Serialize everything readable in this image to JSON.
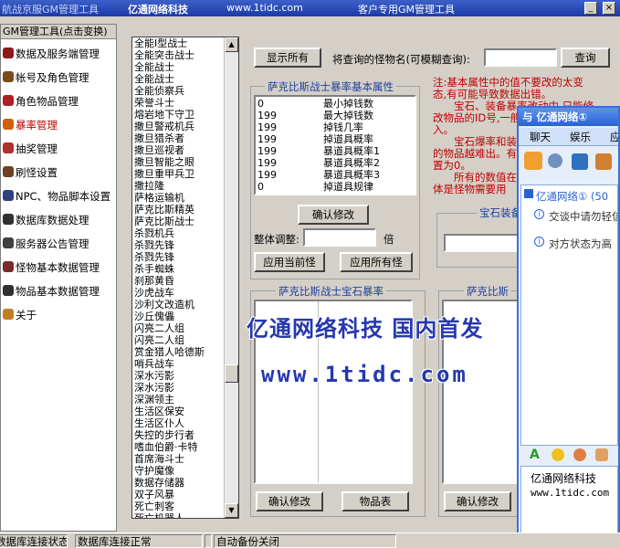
{
  "titlebar": {
    "app_name": "航战京服GM管理工具",
    "company": "亿通网络科技",
    "url": "www.1tidc.com",
    "subtitle": "客户专用GM管理工具",
    "min_glyph": "_",
    "close_glyph": "×"
  },
  "nav": {
    "header": "GM管理工具(点击变换)",
    "items": [
      {
        "label": "数据及服务端管理",
        "icon": "book-icon",
        "color": "#8b1a1a"
      },
      {
        "label": "帐号及角色管理",
        "icon": "key-icon",
        "color": "#7a4a1a"
      },
      {
        "label": "角色物品管理",
        "icon": "bag-icon",
        "color": "#b02020"
      },
      {
        "label": "暴率管理",
        "icon": "dice-icon",
        "color": "#d06010"
      },
      {
        "label": "抽奖管理",
        "icon": "lottery-icon",
        "color": "#b03030"
      },
      {
        "label": "刷怪设置",
        "icon": "monster-icon",
        "color": "#704020"
      },
      {
        "label": "NPC、物品脚本设置",
        "icon": "script-icon",
        "color": "#304080"
      },
      {
        "label": "数据库数据处理",
        "icon": "database-icon",
        "color": "#303030"
      },
      {
        "label": "服务器公告管理",
        "icon": "announce-icon",
        "color": "#404040"
      },
      {
        "label": "怪物基本数据管理",
        "icon": "beast-icon",
        "color": "#7a2a2a"
      },
      {
        "label": "物品基本数据管理",
        "icon": "item-icon",
        "color": "#303030"
      },
      {
        "label": "关于",
        "icon": "info-icon",
        "color": "#c08020"
      }
    ]
  },
  "monster_list": [
    "全能I型战士",
    "全能突击战士",
    "全能战士",
    "全能战士",
    "全能侦察兵",
    "荣誉斗士",
    "熔岩地下守卫",
    "撒旦警戒机兵",
    "撒旦猎杀者",
    "撒旦巡视者",
    "撒旦智能之眼",
    "撒旦重甲兵卫",
    "撒拉隆",
    "萨格运输机",
    "萨克比斯精英",
    "萨克比斯战士",
    "杀戮机兵",
    "杀戮先锋",
    "杀戮先锋",
    "杀手蜘蛛",
    "刹那黄昏",
    "沙虎战车",
    "沙利文改造机",
    "沙丘傀儡",
    "闪亮二人组",
    "闪亮二人组",
    "赏金猎人哈德斯",
    "哨兵战车",
    "深水污影",
    "深水污影",
    "深渊领主",
    "生活区保安",
    "生活区仆人",
    "失控的步行者",
    "嗜血伯爵·卡特",
    "首席海斗士",
    "守护魔像",
    "数据存储器",
    "双子风暴",
    "死亡刺客",
    "死亡机器人"
  ],
  "search": {
    "show_all": "显示所有",
    "label": "将查询的怪物名(可模糊查询):",
    "value": "",
    "button": "查询"
  },
  "drop_group": {
    "title": "萨克比斯战士暴率基本属性",
    "rows": [
      {
        "value": "0",
        "name": "最小掉钱数"
      },
      {
        "value": "199",
        "name": "最大掉钱数"
      },
      {
        "value": "199",
        "name": "掉钱几率"
      },
      {
        "value": "199",
        "name": "掉道具概率"
      },
      {
        "value": "199",
        "name": "暴道具概率1"
      },
      {
        "value": "199",
        "name": "暴道具概率2"
      },
      {
        "value": "199",
        "name": "暴道具概率3"
      },
      {
        "value": "0",
        "name": "掉道具规律"
      }
    ],
    "confirm": "确认修改",
    "adjust_label": "整体调整:",
    "adjust_value": "",
    "adjust_unit": "倍",
    "apply_current": "应用当前怪",
    "apply_all": "应用所有怪"
  },
  "gem_group_right": {
    "title": "宝石装备"
  },
  "gem_drop_group": {
    "title": "萨克比斯战士宝石暴率",
    "confirm": "确认修改",
    "item_table": "物品表"
  },
  "gem_drop_group2": {
    "title": "萨克比斯",
    "confirm": "确认修改"
  },
  "note": {
    "lines": [
      "注:基本属性中的值不要改的太变",
      "态,有可能导致数据出错。",
      "　　宝石、装备暴率改动中,只能修",
      "改物品的ID号,一般",
      "入。",
      "　　宝石爆率和装",
      "的物品越难出。有",
      "置为0。",
      "　　所有的数值在",
      "体是怪物需要用"
    ]
  },
  "watermark": {
    "line1": "亿通网络科技 国内首发",
    "line2": "www.1tidc.com"
  },
  "chat": {
    "title": "与 亿通网络①",
    "tabs": [
      "聊天",
      "娱乐",
      "应"
    ],
    "contact": "亿通网络① (50",
    "msg1": "交谈中请勿轻信",
    "msg2": "对方状态为高",
    "sig_name": "亿通网络科技",
    "sig_url": "www.1tidc.com"
  },
  "statusbar": {
    "seg1": "数据库连接状态",
    "seg2": "数据库连接正常",
    "seg3": "",
    "seg4": "自动备份关闭"
  }
}
